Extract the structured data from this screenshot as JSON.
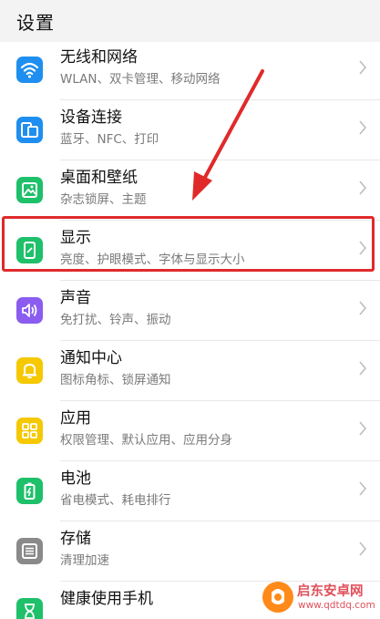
{
  "header": {
    "title": "设置"
  },
  "items": [
    {
      "title": "无线和网络",
      "subtitle": "WLAN、双卡管理、移动网络",
      "icon": "wifi-icon",
      "color": "#1e8ff0"
    },
    {
      "title": "设备连接",
      "subtitle": "蓝牙、NFC、打印",
      "icon": "device-connection-icon",
      "color": "#1e8ff0"
    },
    {
      "title": "桌面和壁纸",
      "subtitle": "杂志锁屏、主题",
      "icon": "wallpaper-icon",
      "color": "#1ec06a"
    },
    {
      "title": "显示",
      "subtitle": "亮度、护眼模式、字体与显示大小",
      "icon": "display-icon",
      "color": "#1ec06a"
    },
    {
      "title": "声音",
      "subtitle": "免打扰、铃声、振动",
      "icon": "sound-icon",
      "color": "#8a5cf0"
    },
    {
      "title": "通知中心",
      "subtitle": "图标角标、锁屏通知",
      "icon": "bell-icon",
      "color": "#f5c800"
    },
    {
      "title": "应用",
      "subtitle": "权限管理、默认应用、应用分身",
      "icon": "apps-grid-icon",
      "color": "#f5c800"
    },
    {
      "title": "电池",
      "subtitle": "省电模式、耗电排行",
      "icon": "battery-icon",
      "color": "#1ec06a"
    },
    {
      "title": "存储",
      "subtitle": "清理加速",
      "icon": "storage-icon",
      "color": "#8a8a8a"
    },
    {
      "title": "健康使用手机",
      "subtitle": "",
      "icon": "hourglass-icon",
      "color": "#1ec06a"
    }
  ],
  "watermark": {
    "title": "启东安卓网",
    "url": "www.qdtdq.com"
  },
  "colors": {
    "highlight": "#e02a2a",
    "background": "#f3f3f3"
  }
}
